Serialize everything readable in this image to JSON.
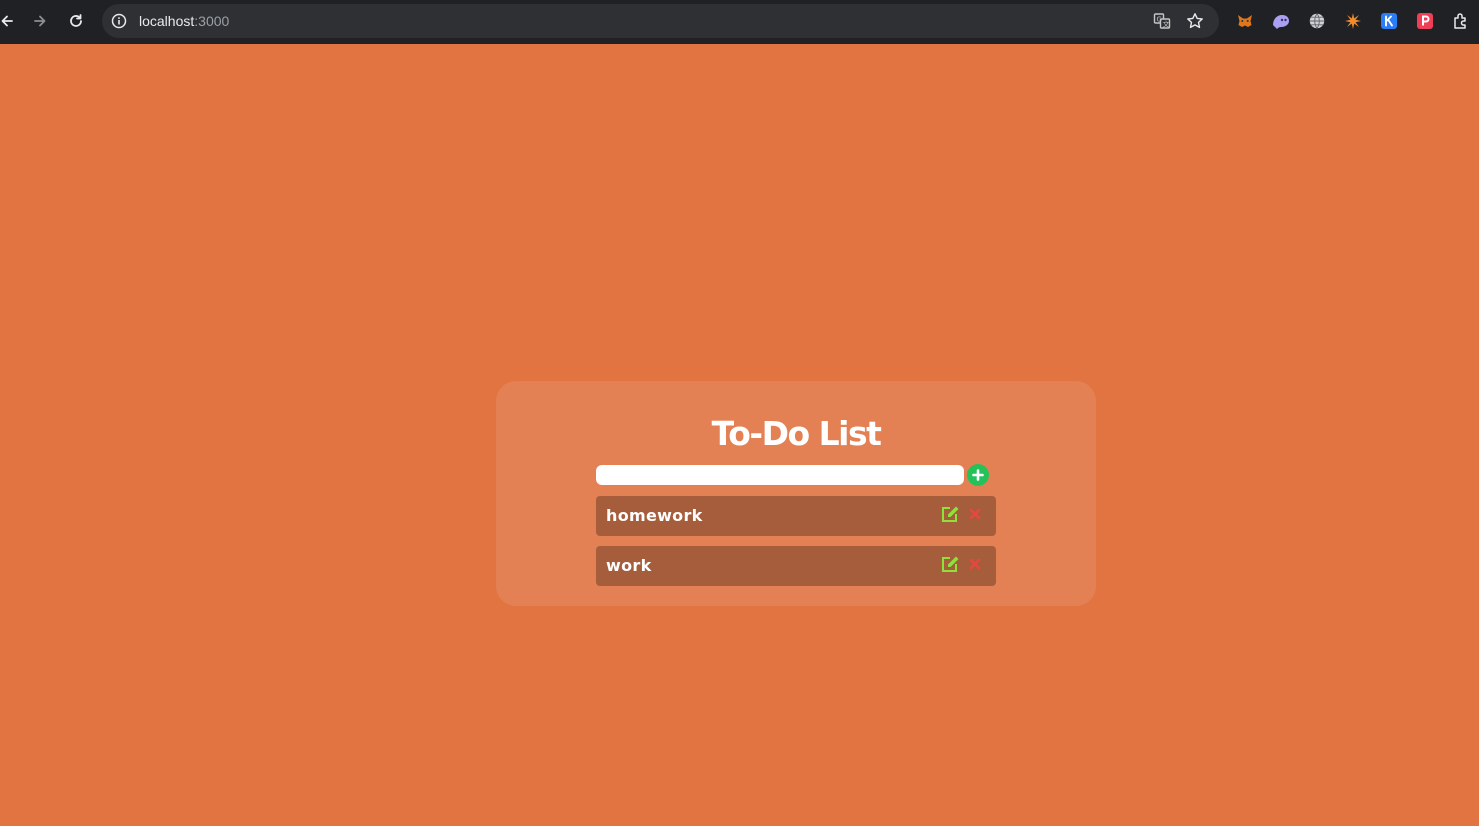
{
  "browser": {
    "url_host": "localhost",
    "url_port": ":3000",
    "extension_icons": [
      "metamask-icon",
      "ghost-icon",
      "globe-icon",
      "spark-icon",
      "k-extension-icon",
      "p-extension-icon",
      "extensions-puzzle-icon"
    ]
  },
  "app": {
    "title": "To-Do List",
    "input": {
      "value": "",
      "placeholder": ""
    },
    "add_button_symbol": "+",
    "todos": [
      {
        "text": "homework"
      },
      {
        "text": "work"
      }
    ],
    "colors": {
      "background": "#e17440",
      "card": "#e38155",
      "item": "#a55d3b",
      "add": "#25c25a",
      "edit": "#8ee03a",
      "delete": "#e8473f"
    }
  }
}
